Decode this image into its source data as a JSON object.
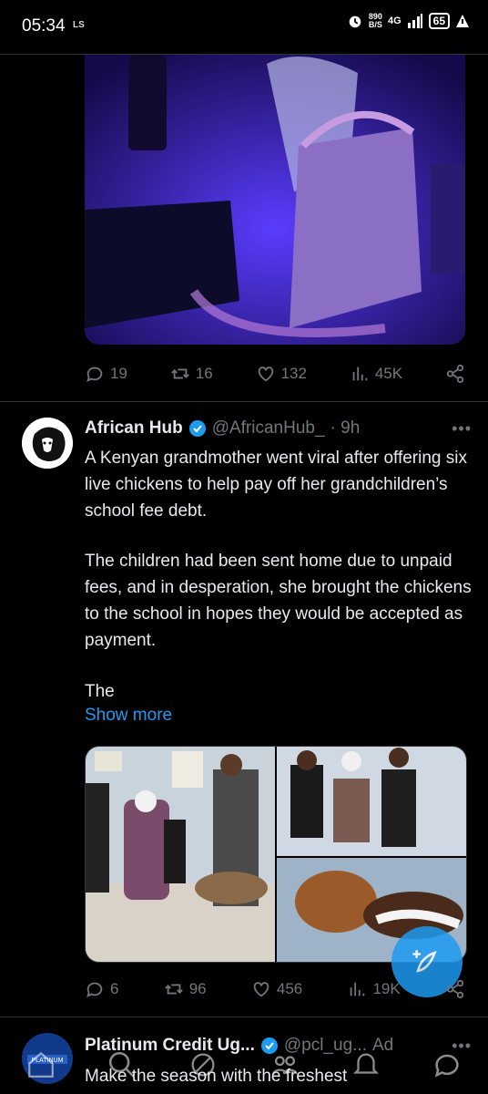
{
  "status_bar": {
    "time": "05:34",
    "carrier_badge": "LS",
    "net_speed_value": "890",
    "net_speed_unit": "B/S",
    "net_type": "4G",
    "battery": "65"
  },
  "tweet1": {
    "replies": "19",
    "reposts": "16",
    "likes": "132",
    "views": "45K"
  },
  "tweet2": {
    "author_name": "African Hub",
    "author_handle": "@AfricanHub_",
    "time": "· 9h",
    "paragraph1": "A Kenyan grandmother went viral after offering six live chickens to help pay off her grandchildren’s school fee debt.",
    "paragraph2": "The children had been sent home due to unpaid fees, and in desperation, she brought the chickens to the school in hopes they would be accepted as payment.",
    "paragraph3": "The",
    "show_more": "Show more",
    "replies": "6",
    "reposts": "96",
    "likes": "456",
    "views": "19K"
  },
  "ad": {
    "author_name": "Platinum Credit Ug...",
    "author_handle": "@pcl_ug...",
    "ad_label": "Ad",
    "text": "Make the season with the freshest",
    "avatar_text": "PLATINUM"
  },
  "colors": {
    "accent": "#1d9bf0",
    "muted": "#71767b",
    "background": "#000000"
  }
}
